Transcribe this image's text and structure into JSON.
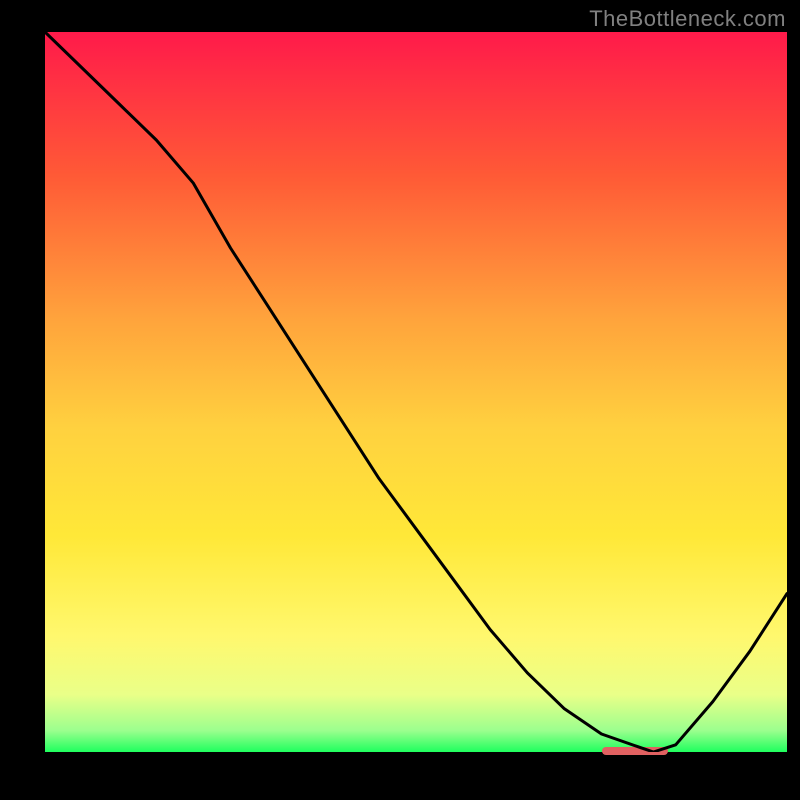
{
  "watermark": "TheBottleneck.com",
  "chart_data": {
    "type": "line",
    "title": "",
    "xlabel": "",
    "ylabel": "",
    "xlim": [
      0,
      100
    ],
    "ylim": [
      0,
      100
    ],
    "grid": false,
    "x": [
      0,
      5,
      10,
      15,
      20,
      25,
      30,
      35,
      40,
      45,
      50,
      55,
      60,
      65,
      70,
      75,
      80,
      82,
      85,
      90,
      95,
      100
    ],
    "values": [
      100,
      95,
      90,
      85,
      79,
      70,
      62,
      54,
      46,
      38,
      31,
      24,
      17,
      11,
      6,
      2.5,
      0.7,
      0,
      1,
      7,
      14,
      22
    ],
    "pink_marker": {
      "x_start": 75,
      "x_end": 84,
      "y": 0
    },
    "background_gradient": {
      "stops": [
        {
          "color": "#ff1a4a",
          "pos": 0
        },
        {
          "color": "#ff5a36",
          "pos": 20
        },
        {
          "color": "#ffa43c",
          "pos": 40
        },
        {
          "color": "#ffd13f",
          "pos": 55
        },
        {
          "color": "#ffe838",
          "pos": 70
        },
        {
          "color": "#fff86e",
          "pos": 84
        },
        {
          "color": "#eaff88",
          "pos": 92
        },
        {
          "color": "#9cff8e",
          "pos": 97
        },
        {
          "color": "#1fff5e",
          "pos": 100
        }
      ]
    }
  }
}
